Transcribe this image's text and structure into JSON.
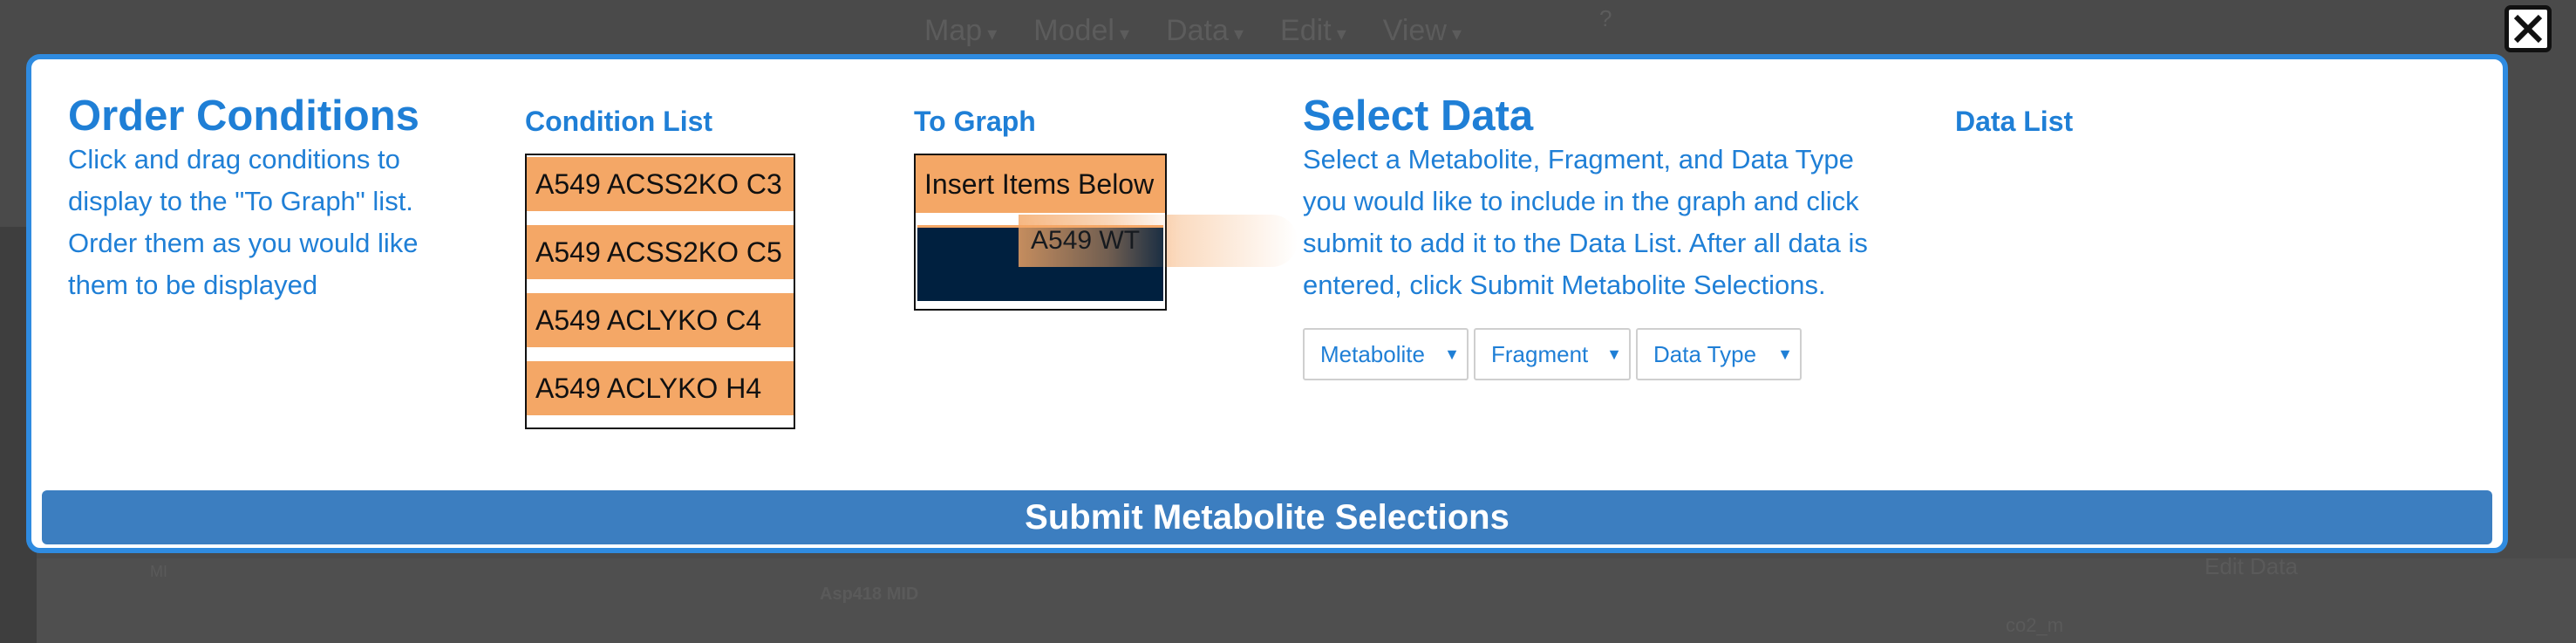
{
  "background": {
    "nav": [
      "Map",
      "Model",
      "Data",
      "Edit",
      "View"
    ],
    "help": "?",
    "label_asp": "Asp418 MID",
    "label_edit_data": "Edit Data",
    "label_co2": "co2_m",
    "label_mi": "MI"
  },
  "modal": {
    "order_conditions": {
      "title": "Order Conditions",
      "description": "Click and drag conditions to display to the \"To Graph\" list. Order them as you would like them to be displayed"
    },
    "condition_list": {
      "title": "Condition List",
      "items": [
        "A549 ACSS2KO C3",
        "A549 ACSS2KO C5",
        "A549 ACLYKO C4",
        "A549 ACLYKO H4"
      ]
    },
    "to_graph": {
      "title": "To Graph",
      "header": "Insert Items Below",
      "dragging_item": "A549 WT"
    },
    "select_data": {
      "title": "Select Data",
      "description": "Select a Metabolite, Fragment, and Data Type you would like to include in the graph and click submit to add it to the Data List. After all data is entered, click Submit Metabolite Selections.",
      "dropdowns": [
        "Metabolite",
        "Fragment",
        "Data Type"
      ]
    },
    "data_list": {
      "title": "Data List"
    },
    "submit_label": "Submit Metabolite Selections"
  },
  "colors": {
    "accent": "#1f7fd6",
    "item_orange": "#f4a766",
    "drop_zone": "#00203f",
    "submit_bg": "#3c7ec0"
  },
  "icons": {
    "close": "close-icon",
    "dropdown": "triangle-down-icon"
  }
}
